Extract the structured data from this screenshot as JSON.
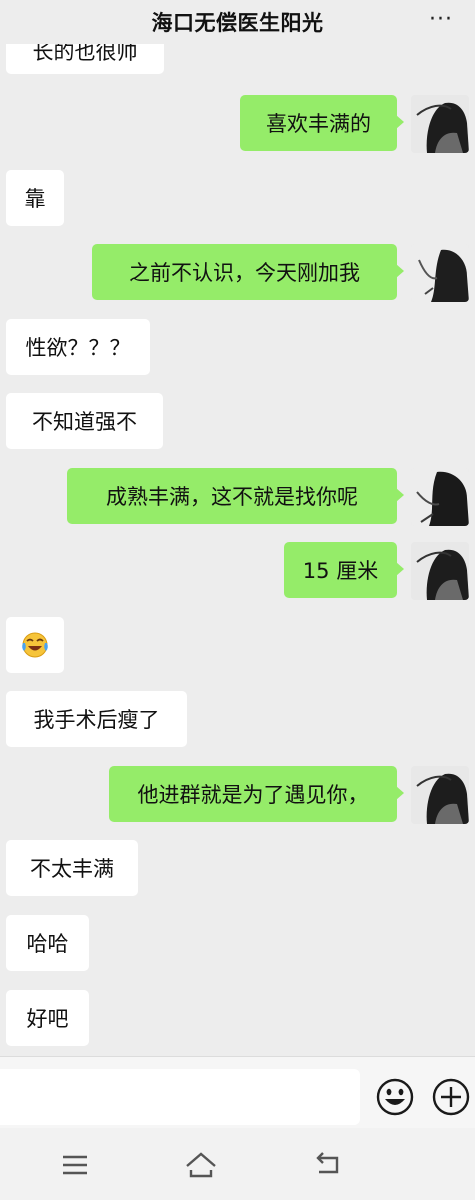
{
  "header": {
    "title": "海口无偿医生阳光",
    "more_label": "···"
  },
  "messages": [
    {
      "side": "in",
      "text": "长的也很帅"
    },
    {
      "side": "out",
      "text": "喜欢丰满的"
    },
    {
      "side": "in",
      "text": "靠"
    },
    {
      "side": "out",
      "text": "之前不认识，今天刚加我"
    },
    {
      "side": "in",
      "text": "性欲？？？"
    },
    {
      "side": "in",
      "text": "不知道强不"
    },
    {
      "side": "out",
      "text": "成熟丰满，这不就是找你呢"
    },
    {
      "side": "out",
      "text": "15 厘米"
    },
    {
      "side": "in",
      "text": "",
      "emoji": "crying-laughing-emoji"
    },
    {
      "side": "in",
      "text": "我手术后瘦了"
    },
    {
      "side": "out",
      "text": "他进群就是为了遇见你，"
    },
    {
      "side": "in",
      "text": "不太丰满"
    },
    {
      "side": "in",
      "text": "哈哈"
    },
    {
      "side": "in",
      "text": "好吧"
    }
  ],
  "input_bar": {
    "value": "",
    "icons": [
      "emoji-icon",
      "plus-icon"
    ]
  },
  "system_nav": {
    "icons": [
      "menu-icon",
      "home-icon",
      "back-icon"
    ]
  },
  "colors": {
    "background": "#ededed",
    "incoming_bubble": "#ffffff",
    "outgoing_bubble": "#95ec69",
    "text": "#111111"
  }
}
